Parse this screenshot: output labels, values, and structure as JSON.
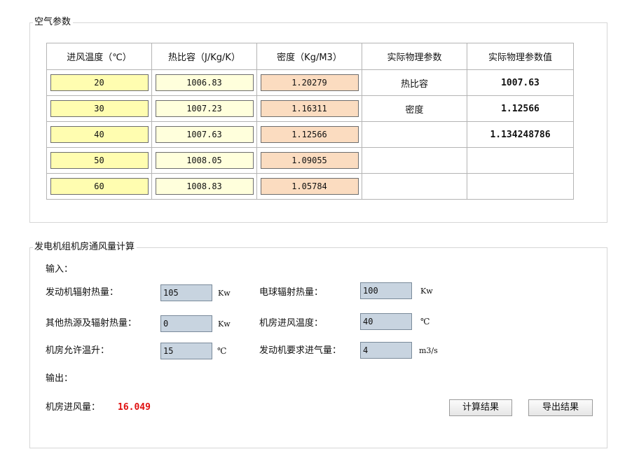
{
  "air_group": {
    "title": "空气参数",
    "headers": [
      "进风温度（℃）",
      "热比容（J/Kg/K）",
      "密度（Kg/M3）",
      "实际物理参数",
      "实际物理参数值"
    ],
    "rows": [
      {
        "temp": "20",
        "heat": "1006.83",
        "density": "1.20279",
        "phys_label": "热比容",
        "phys_value": "1007.63"
      },
      {
        "temp": "30",
        "heat": "1007.23",
        "density": "1.16311",
        "phys_label": "密度",
        "phys_value": "1.12566"
      },
      {
        "temp": "40",
        "heat": "1007.63",
        "density": "1.12566",
        "phys_label": "",
        "phys_value": "1.134248786"
      },
      {
        "temp": "50",
        "heat": "1008.05",
        "density": "1.09055",
        "phys_label": "",
        "phys_value": ""
      },
      {
        "temp": "60",
        "heat": "1008.83",
        "density": "1.05784",
        "phys_label": "",
        "phys_value": ""
      }
    ]
  },
  "calc_group": {
    "title": "发电机组机房通风量计算",
    "input_label": "输入：",
    "output_label": "输出：",
    "fields": {
      "engine_heat": {
        "label": "发动机辐射热量：",
        "value": "105",
        "unit": "Kw"
      },
      "alternator_heat": {
        "label": "电球辐射热量：",
        "value": "100",
        "unit": "Kw"
      },
      "other_heat": {
        "label": "其他热源及辐射热量：",
        "value": "0",
        "unit": "Kw"
      },
      "inlet_temp": {
        "label": "机房进风温度：",
        "value": "40",
        "unit": "℃"
      },
      "allowed_rise": {
        "label": "机房允许温升：",
        "value": "15",
        "unit": "℃"
      },
      "engine_air": {
        "label": "发动机要求进气量：",
        "value": "4",
        "unit": "m3/s"
      }
    },
    "result": {
      "label": "机房进风量：",
      "value": "16.049"
    },
    "buttons": {
      "calculate": "计算结果",
      "export": "导出结果"
    }
  }
}
